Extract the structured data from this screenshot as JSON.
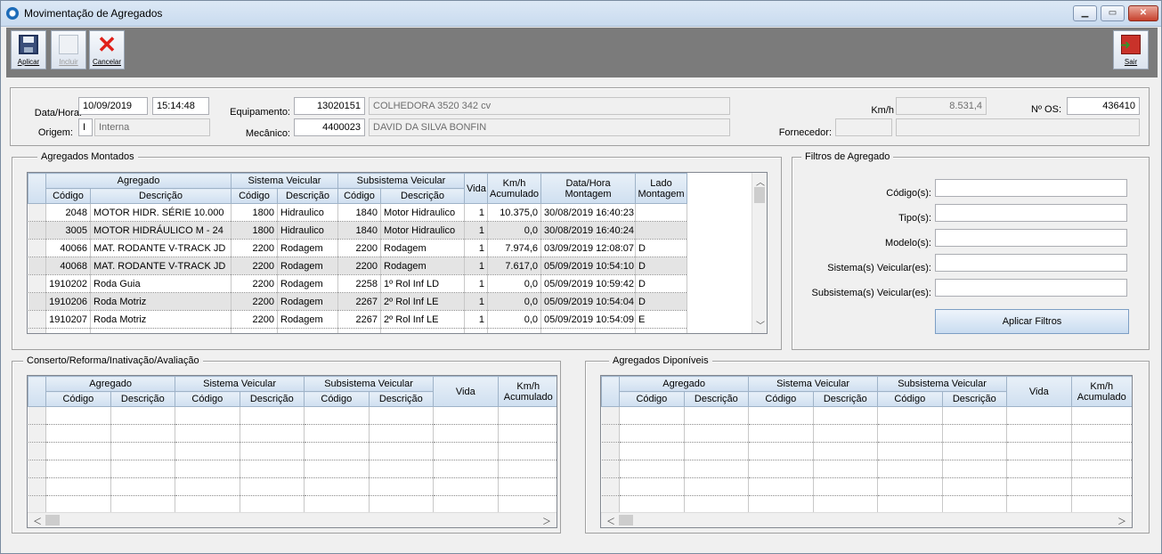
{
  "window": {
    "title": "Movimentação de Agregados"
  },
  "toolbar": {
    "apply_label": "Aplicar",
    "include_label": "Incluir",
    "cancel_label": "Cancelar",
    "exit_label": "Sair"
  },
  "header": {
    "datetime_label": "Data/Hora:",
    "date": "10/09/2019",
    "time": "15:14:48",
    "origin_label": "Origem:",
    "origin_code": "I",
    "origin_desc": "Interna",
    "equipment_label": "Equipamento:",
    "equipment_code": "13020151",
    "equipment_desc": "COLHEDORA 3520 342 cv",
    "mechanic_label": "Mecânico:",
    "mechanic_code": "4400023",
    "mechanic_name": "DAVID DA SILVA BONFIN",
    "km_label": "Km/h",
    "km_value": "8.531,4",
    "os_label": "Nº OS:",
    "os_value": "436410",
    "supplier_label": "Fornecedor:",
    "supplier_code": "",
    "supplier_name": ""
  },
  "mounted": {
    "legend": "Agregados Montados",
    "group_headers": {
      "agregado": "Agregado",
      "sistema": "Sistema Veicular",
      "subsistema": "Subsistema Veicular",
      "vida": "Vida",
      "km": "Km/h\nAcumulado",
      "km1": "Km/h",
      "km2": "Acumulado",
      "data1": "Data/Hora",
      "data2": "Montagem",
      "lado1": "Lado",
      "lado2": "Montagem"
    },
    "columns": {
      "codigo": "Código",
      "descricao": "Descrição"
    },
    "rows": [
      {
        "cod": "2048",
        "desc": "MOTOR HIDR. SÉRIE 10.000",
        "sis_cod": "1800",
        "sis_desc": "Hidraulico",
        "sub_cod": "1840",
        "sub_desc": "Motor Hidraulico",
        "vida": "1",
        "km": "10.375,0",
        "data": "30/08/2019 16:40:23",
        "lado": ""
      },
      {
        "cod": "3005",
        "desc": "MOTOR HIDRÁULICO M - 24",
        "sis_cod": "1800",
        "sis_desc": "Hidraulico",
        "sub_cod": "1840",
        "sub_desc": "Motor Hidraulico",
        "vida": "1",
        "km": "0,0",
        "data": "30/08/2019 16:40:24",
        "lado": ""
      },
      {
        "cod": "40066",
        "desc": "MAT. RODANTE V-TRACK JD",
        "sis_cod": "2200",
        "sis_desc": "Rodagem",
        "sub_cod": "2200",
        "sub_desc": "Rodagem",
        "vida": "1",
        "km": "7.974,6",
        "data": "03/09/2019 12:08:07",
        "lado": "D"
      },
      {
        "cod": "40068",
        "desc": "MAT. RODANTE V-TRACK JD",
        "sis_cod": "2200",
        "sis_desc": "Rodagem",
        "sub_cod": "2200",
        "sub_desc": "Rodagem",
        "vida": "1",
        "km": "7.617,0",
        "data": "05/09/2019 10:54:10",
        "lado": "D"
      },
      {
        "cod": "1910202",
        "desc": "Roda Guia",
        "sis_cod": "2200",
        "sis_desc": "Rodagem",
        "sub_cod": "2258",
        "sub_desc": "1º Rol Inf LD",
        "vida": "1",
        "km": "0,0",
        "data": "05/09/2019 10:59:42",
        "lado": "D"
      },
      {
        "cod": "1910206",
        "desc": "Roda Motriz",
        "sis_cod": "2200",
        "sis_desc": "Rodagem",
        "sub_cod": "2267",
        "sub_desc": "2º Rol Inf LE",
        "vida": "1",
        "km": "0,0",
        "data": "05/09/2019 10:54:04",
        "lado": "D"
      },
      {
        "cod": "1910207",
        "desc": "Roda Motriz",
        "sis_cod": "2200",
        "sis_desc": "Rodagem",
        "sub_cod": "2267",
        "sub_desc": "2º Rol Inf LE",
        "vida": "1",
        "km": "0,0",
        "data": "05/09/2019 10:54:09",
        "lado": "E"
      }
    ]
  },
  "filters": {
    "legend": "Filtros de Agregado",
    "codigo_label": "Código(s):",
    "tipo_label": "Tipo(s):",
    "modelo_label": "Modelo(s):",
    "sistema_label": "Sistema(s) Veicular(es):",
    "subsistema_label": "Subsistema(s) Veicular(es):",
    "apply_button": "Aplicar Filtros"
  },
  "repair": {
    "legend": "Conserto/Reforma/Inativação/Avaliação"
  },
  "available": {
    "legend": "Agregados Diponíveis"
  },
  "small_grid": {
    "agregado": "Agregado",
    "sistema": "Sistema Veicular",
    "subsistema": "Subsistema Veicular",
    "codigo": "Código",
    "descricao": "Descrição",
    "vida": "Vida",
    "km1": "Km/h",
    "km2": "Acumulado"
  }
}
